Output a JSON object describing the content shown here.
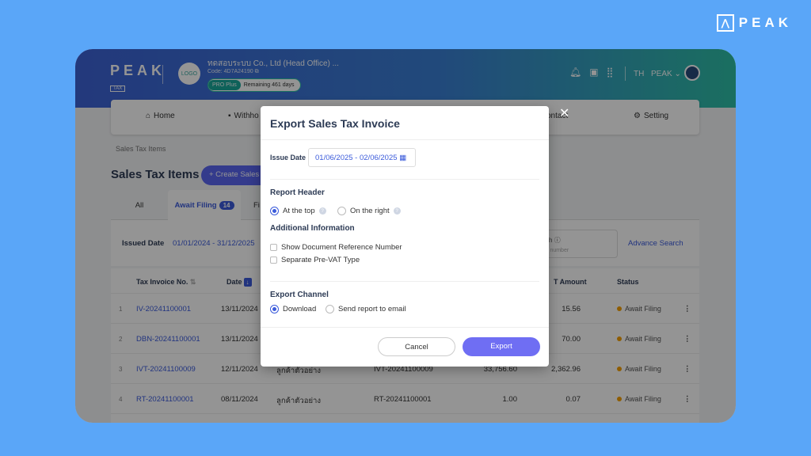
{
  "brand": {
    "icon": "peak-logo-icon",
    "text": "PEAK"
  },
  "topbar": {
    "logo": "PEAK",
    "logo_tag": "TAX",
    "company_logo": "LOGO",
    "company_name": "ทดสอบระบบ Co., Ltd (Head Office) ...",
    "company_code": "Code: 4D7A24190",
    "plan": "PRO Plus",
    "remaining": "Remaining 461 days",
    "language": "TH",
    "user": "PEAK ⌄"
  },
  "nav": {
    "home": "Home",
    "withholding": "Withho",
    "contact": "ontact",
    "setting": "Setting"
  },
  "breadcrumb": "Sales Tax Items",
  "page_title": "Sales Tax Items",
  "create_button": "+ Create Sales T",
  "tabs": {
    "all": "All",
    "await_filing": "Await Filing",
    "await_count": "14",
    "filed": "Fi"
  },
  "filter": {
    "issued_date_label": "Issued Date",
    "issued_date_value": "01/01/2024 - 31/12/2025",
    "search_label": "ch",
    "search_placeholder": "y number",
    "advance_search": "Advance Search"
  },
  "table": {
    "headers": {
      "tax_invoice_no": "Tax Invoice No.",
      "date": "Date",
      "vat_amount": "T Amount",
      "status": "Status"
    },
    "rows": [
      {
        "no": "1",
        "invoice": "IV-20241100001",
        "date": "13/11/2024",
        "customer": "",
        "ref": "",
        "amount": "",
        "vat": "15.56",
        "status": "Await Filing"
      },
      {
        "no": "2",
        "invoice": "DBN-20241100001",
        "date": "13/11/2024",
        "customer": "",
        "ref": "",
        "amount": "",
        "vat": "70.00",
        "status": "Await Filing"
      },
      {
        "no": "3",
        "invoice": "IVT-20241100009",
        "date": "12/11/2024",
        "customer": "ลูกค้าตัวอย่าง",
        "ref": "IVT-20241100009",
        "amount": "33,756.60",
        "vat": "2,362.96",
        "status": "Await Filing"
      },
      {
        "no": "4",
        "invoice": "RT-20241100001",
        "date": "08/11/2024",
        "customer": "ลูกค้าตัวอย่าง",
        "ref": "RT-20241100001",
        "amount": "1.00",
        "vat": "0.07",
        "status": "Await Filing"
      }
    ]
  },
  "modal": {
    "title": "Export Sales Tax Invoice",
    "close": "✕",
    "issue_date_label": "Issue Date",
    "issue_date_value": "01/06/2025 - 02/06/2025",
    "report_header": "Report Header",
    "at_top": "At the top",
    "on_right": "On the right",
    "additional_info": "Additional Information",
    "show_doc_ref": "Show Document Reference Number",
    "separate_pre_vat": "Separate Pre-VAT Type",
    "export_channel": "Export Channel",
    "download": "Download",
    "send_email": "Send report to email",
    "cancel": "Cancel",
    "export": "Export"
  },
  "colors": {
    "accent": "#3b5bdb",
    "export_button": "#6f6ef3",
    "status_dot": "#f59f00",
    "background": "#5aa6f8"
  }
}
